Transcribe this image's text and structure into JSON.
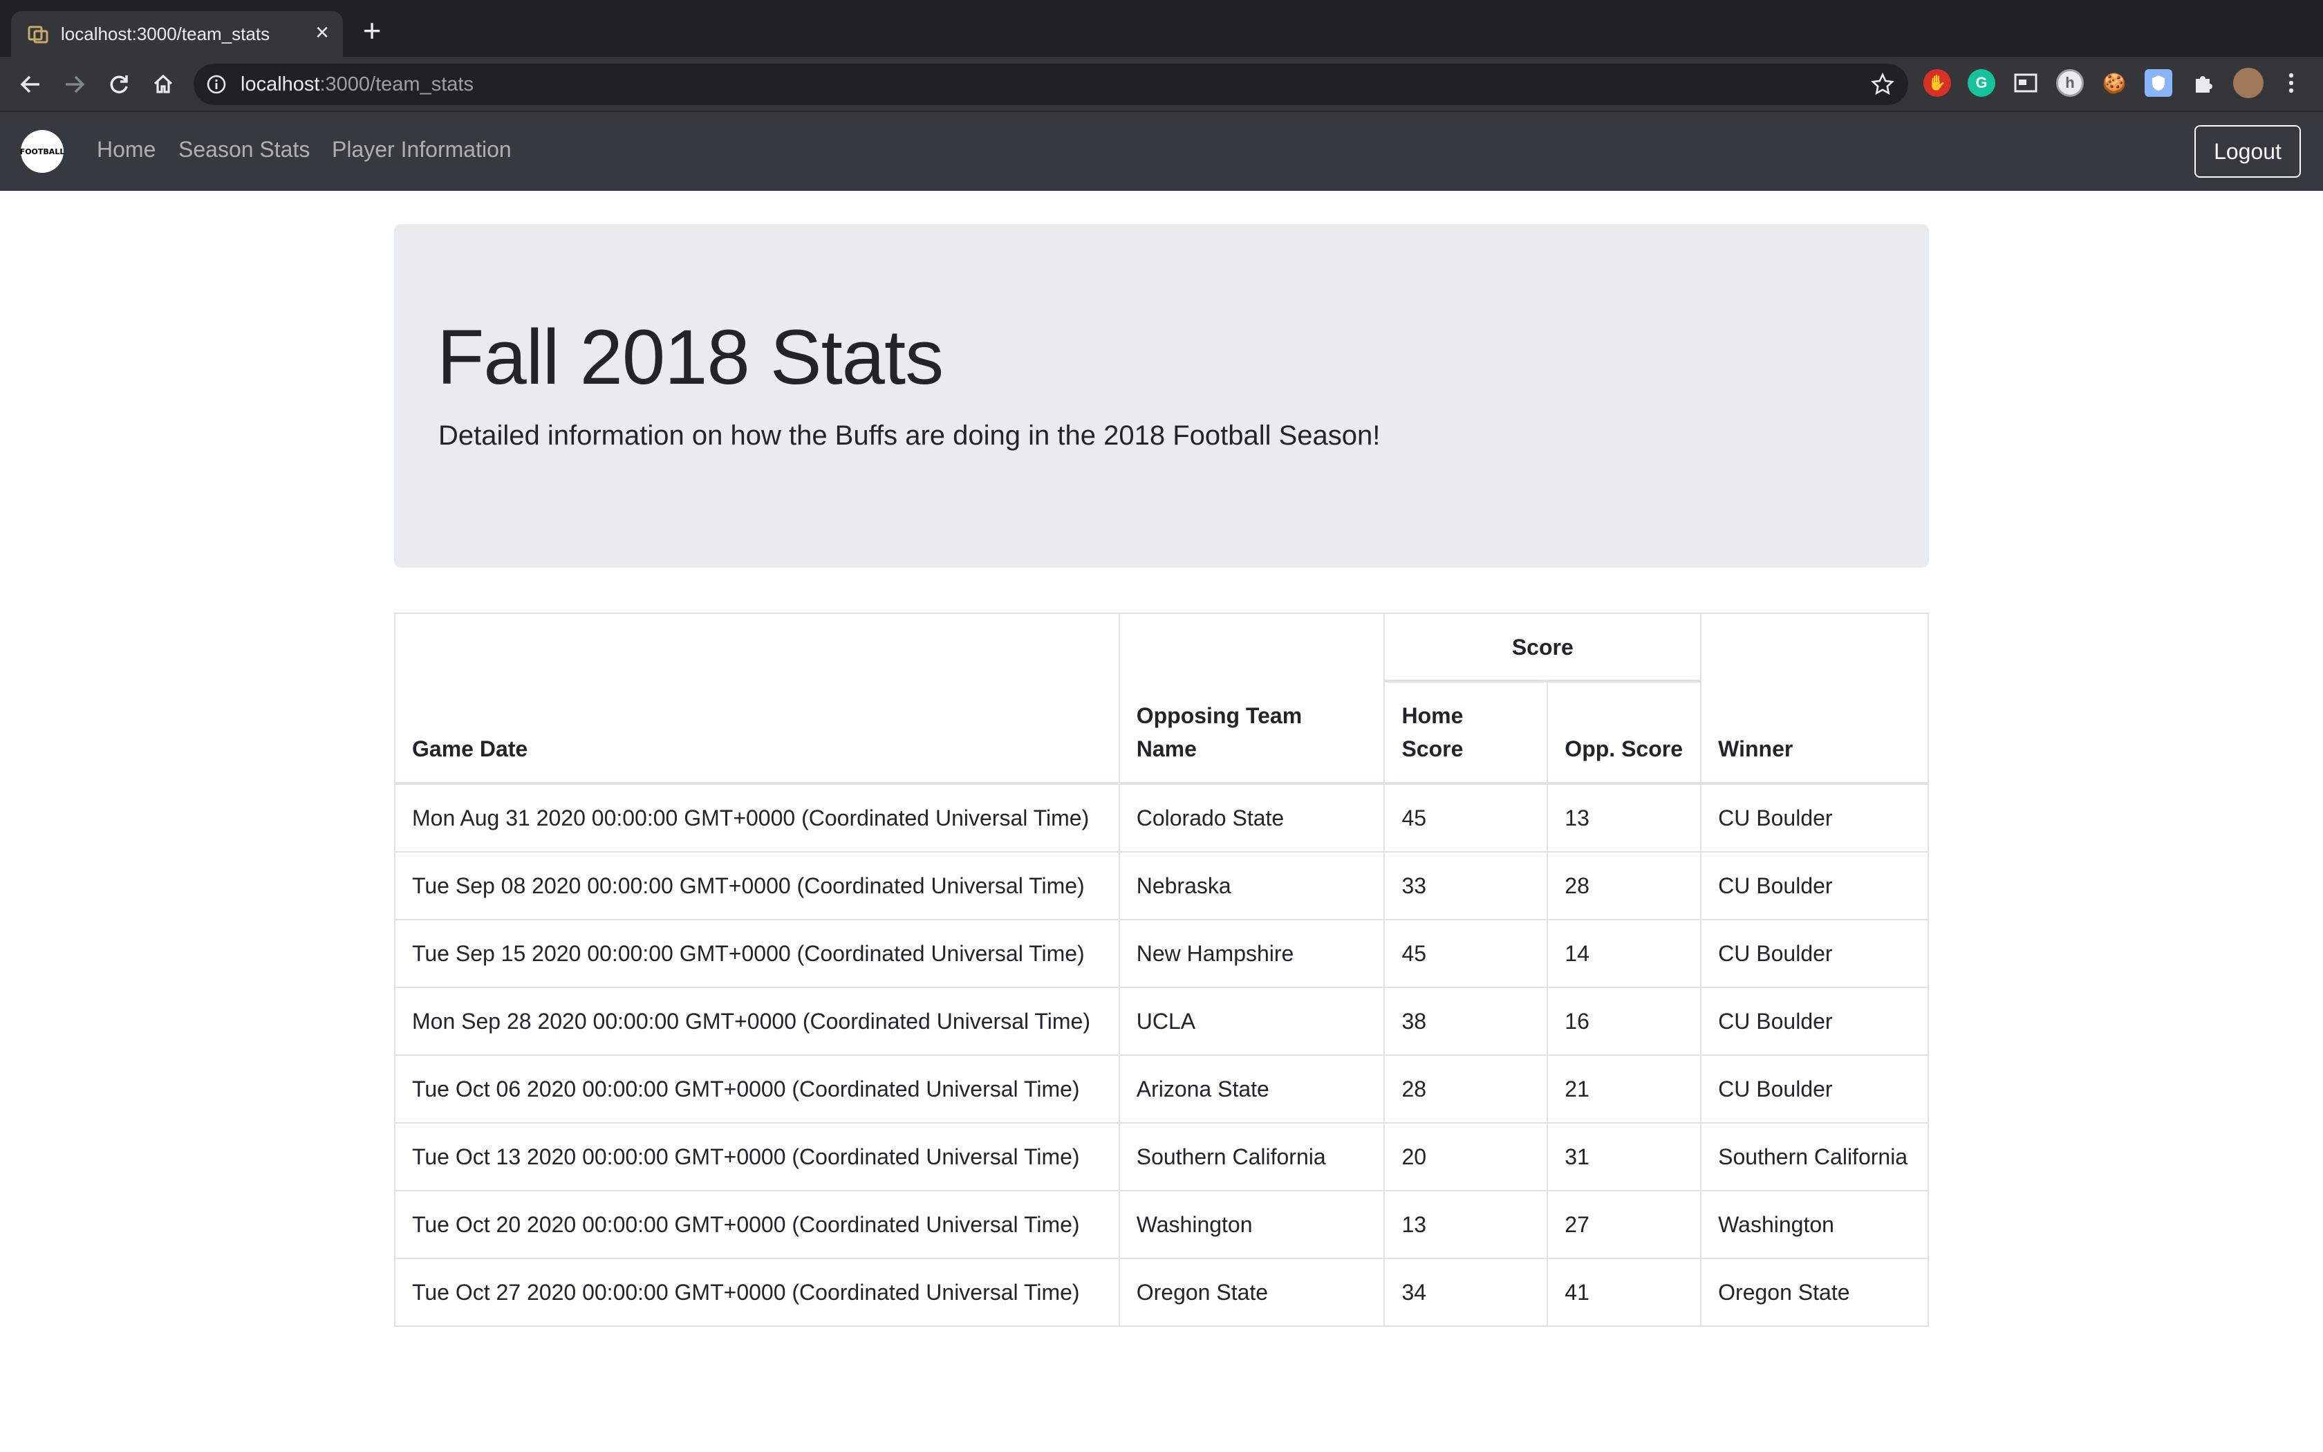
{
  "browser": {
    "tab_title": "localhost:3000/team_stats",
    "url_host": "localhost",
    "url_path": ":3000/team_stats",
    "extensions": [
      "adblock-icon",
      "grammarly-icon",
      "window-icon",
      "profile-h-icon",
      "cookie-icon",
      "shield-ext-icon",
      "puzzle-icon",
      "avatar-icon"
    ]
  },
  "navbar": {
    "brand_text": "FOOTBALL",
    "links": [
      "Home",
      "Season Stats",
      "Player Information"
    ],
    "logout_label": "Logout"
  },
  "jumbotron": {
    "title": "Fall 2018 Stats",
    "lead": "Detailed information on how the Buffs are doing in the 2018 Football Season!"
  },
  "table": {
    "headers": {
      "game_date": "Game Date",
      "opponent": "Opposing Team Name",
      "score_group": "Score",
      "home_score": "Home Score",
      "opp_score": "Opp. Score",
      "winner": "Winner"
    },
    "rows": [
      {
        "date": "Mon Aug 31 2020 00:00:00 GMT+0000 (Coordinated Universal Time)",
        "opponent": "Colorado State",
        "home": "45",
        "opp": "13",
        "winner": "CU Boulder"
      },
      {
        "date": "Tue Sep 08 2020 00:00:00 GMT+0000 (Coordinated Universal Time)",
        "opponent": "Nebraska",
        "home": "33",
        "opp": "28",
        "winner": "CU Boulder"
      },
      {
        "date": "Tue Sep 15 2020 00:00:00 GMT+0000 (Coordinated Universal Time)",
        "opponent": "New Hampshire",
        "home": "45",
        "opp": "14",
        "winner": "CU Boulder"
      },
      {
        "date": "Mon Sep 28 2020 00:00:00 GMT+0000 (Coordinated Universal Time)",
        "opponent": "UCLA",
        "home": "38",
        "opp": "16",
        "winner": "CU Boulder"
      },
      {
        "date": "Tue Oct 06 2020 00:00:00 GMT+0000 (Coordinated Universal Time)",
        "opponent": "Arizona State",
        "home": "28",
        "opp": "21",
        "winner": "CU Boulder"
      },
      {
        "date": "Tue Oct 13 2020 00:00:00 GMT+0000 (Coordinated Universal Time)",
        "opponent": "Southern California",
        "home": "20",
        "opp": "31",
        "winner": "Southern California"
      },
      {
        "date": "Tue Oct 20 2020 00:00:00 GMT+0000 (Coordinated Universal Time)",
        "opponent": "Washington",
        "home": "13",
        "opp": "27",
        "winner": "Washington"
      },
      {
        "date": "Tue Oct 27 2020 00:00:00 GMT+0000 (Coordinated Universal Time)",
        "opponent": "Oregon State",
        "home": "34",
        "opp": "41",
        "winner": "Oregon State"
      }
    ]
  }
}
